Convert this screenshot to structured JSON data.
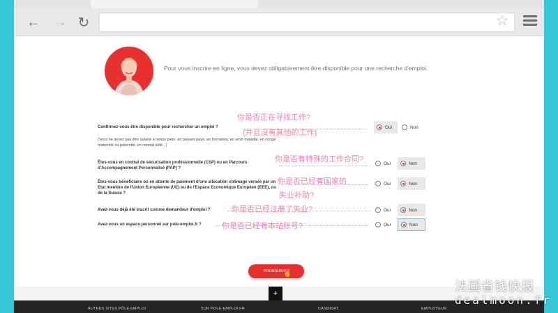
{
  "browser": {
    "nav": {
      "back_icon": "←",
      "forward_icon": "→",
      "reload_icon": "↻"
    },
    "star_icon": "☆"
  },
  "intro_text": "Pour vous inscrire en ligne, vous devez obligatoirement être disponible pour une recherche d'emploi.",
  "questions": [
    {
      "text": "Confirmez-vous être disponible pour rechercher un emploi ?",
      "note": "(Vous ne devez pas être salarié à temps plein, en préavis payé, en formation, en arrêt maladie, en congé maternité ou paternité, en contrat aidé...)",
      "oui": "Oui",
      "non": "Non",
      "selected": "Oui"
    },
    {
      "text": "Êtes-vous en contrat de sécurisation professionnelle (CSP) ou en Parcours d'Accompagnement Personnalisé (PAP) ?",
      "oui": "Oui",
      "non": "Non",
      "selected": "Non"
    },
    {
      "text": "Êtes-vous bénéficiaire ou en attente de paiement d'une allocation chômage versée par un Etat membre de l'Union Européenne (UE) ou de l'Espace Economique Européen (EEE), ou de la Suisse ?",
      "oui": "Oui",
      "non": "Non",
      "selected": "Non"
    },
    {
      "text": "Avez-vous déjà été inscrit comme demandeur d'emploi ?",
      "oui": "Oui",
      "non": "Non",
      "selected": "Non"
    },
    {
      "text": "Avez-vous un espace personnel sur pole-emploi.fr ?",
      "oui": "Oui",
      "non": "Non",
      "selected": "Non"
    }
  ],
  "annotations": [
    "你是否正在寻找工作?",
    "(并且没有其他的工作)",
    "你是否有特殊的工作合同?",
    "你是否已经有国家的",
    "失业补助?",
    "你是否已经注册了失业?",
    "你是否已经有本站账号?"
  ],
  "submit_label": "POURSUIVRE",
  "plus_label": "+",
  "footer": {
    "links": [
      "AUTRES SITES PÔLE EMPLOI",
      "SUR POLE-EMPLOI.FR",
      "CANDIDAT",
      "EMPLOYEUR"
    ]
  },
  "watermark": {
    "line1": "法国省钱快报",
    "line2": "dealmoon.fr"
  },
  "colors": {
    "accent": "#e8312f",
    "teal": "#36c7d6",
    "annotation": "#f07fb1"
  }
}
